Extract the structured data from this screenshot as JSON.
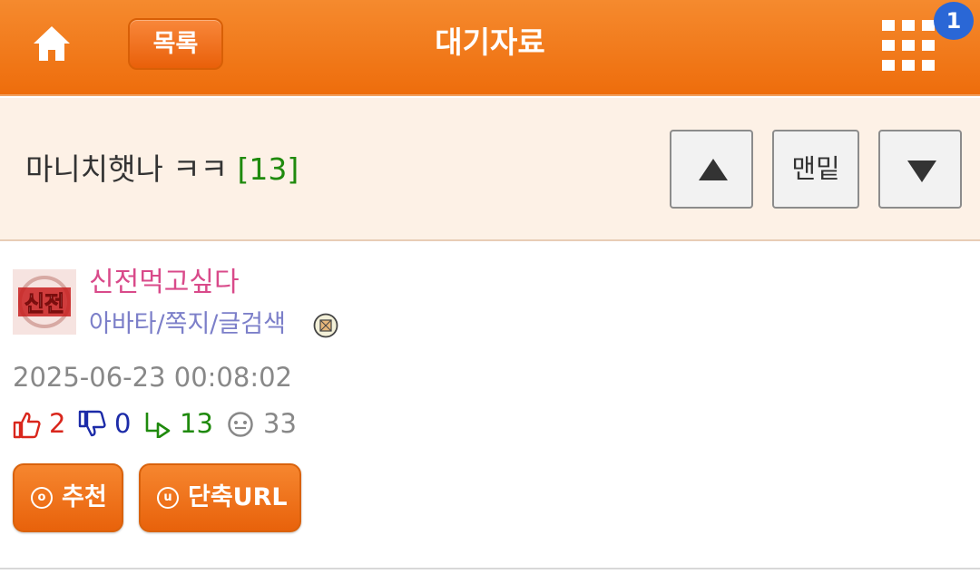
{
  "header": {
    "list_label": "목록",
    "title": "대기자료",
    "notification_count": "1",
    "accent": "#ef6f0e"
  },
  "post": {
    "title": "마니치햇나 ㅋㅋ",
    "comment_count": "[13]"
  },
  "nav": {
    "bottom_label": "맨밑",
    "up_icon": "triangle-up",
    "down_icon": "triangle-down"
  },
  "author": {
    "name": "신전먹고싶다",
    "links": "아바타/쪽지/글검색",
    "avatar_text": "신전"
  },
  "meta": {
    "date": "2025-06-23 00:08:02",
    "likes": "2",
    "dislikes": "0",
    "replies": "13",
    "views": "33",
    "like_color": "#d9261c",
    "dislike_color": "#1c2ba8",
    "reply_color": "#1f8a0d",
    "view_color": "#888888"
  },
  "actions": {
    "recommend_label": "추천",
    "recommend_icon_glyph": "o",
    "shorturl_label": "단축URL",
    "shorturl_icon_glyph": "u"
  }
}
